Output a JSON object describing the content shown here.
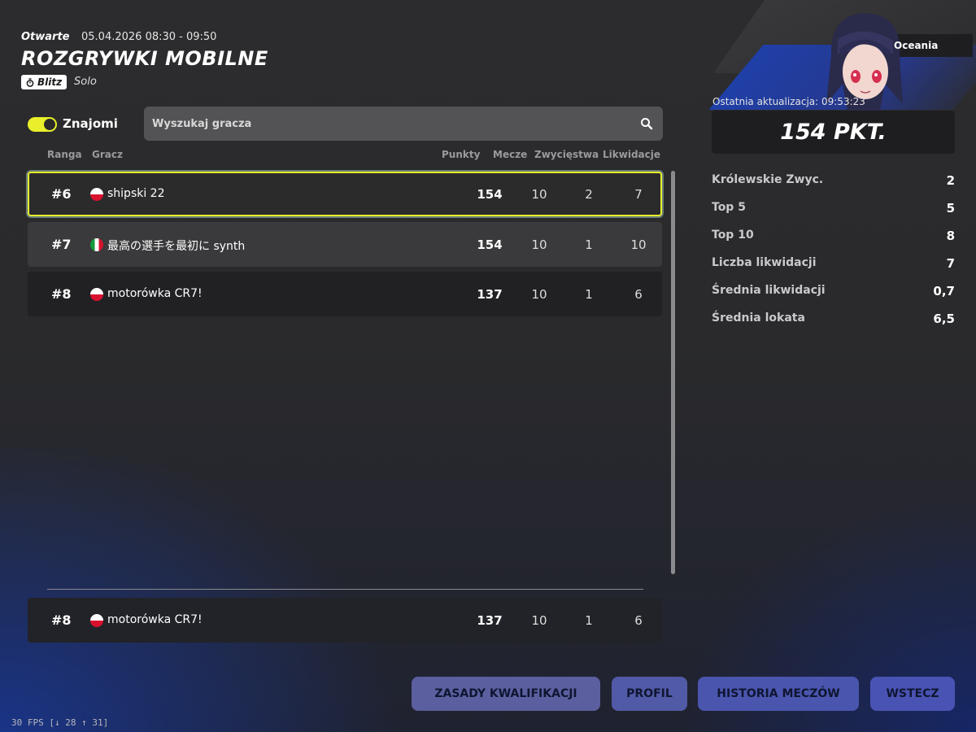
{
  "header": {
    "status": "Otwarte",
    "date_range": "05.04.2026 08:30 - 09:50",
    "title": "ROZGRYWKI MOBILNE",
    "mode_badge": "Blitz",
    "mode_type": "Solo"
  },
  "filters": {
    "friends_toggle_label": "Znajomi",
    "friends_toggle_on": true,
    "search_placeholder": "Wyszukaj gracza"
  },
  "columns": {
    "rank": "Ranga",
    "player": "Gracz",
    "points": "Punkty",
    "matches": "Mecze",
    "wins": "Zwycięstwa",
    "eliminations": "Likwidacje"
  },
  "leaderboard": [
    {
      "rank": "#6",
      "flag": "poland-flag-icon",
      "name": "shipski 22",
      "points": "154",
      "matches": "10",
      "wins": "2",
      "eliminations": "7",
      "selected": true
    },
    {
      "rank": "#7",
      "flag": "italy-flag-icon",
      "name": "最高の選手を最初に synth",
      "points": "154",
      "matches": "10",
      "wins": "1",
      "eliminations": "10"
    },
    {
      "rank": "#8",
      "flag": "poland-flag-icon",
      "name": "motorówka CR7!",
      "points": "137",
      "matches": "10",
      "wins": "1",
      "eliminations": "6"
    }
  ],
  "my_row": {
    "rank": "#8",
    "flag": "poland-flag-icon",
    "name": "motorówka CR7!",
    "points": "137",
    "matches": "10",
    "wins": "1",
    "eliminations": "6"
  },
  "profile": {
    "region": "Oceania",
    "last_update": "Ostatnia aktualizacja: 09:53:23",
    "score": "154 PKT.",
    "stats": [
      {
        "label": "Królewskie Zwyc.",
        "value": "2"
      },
      {
        "label": "Top 5",
        "value": "5"
      },
      {
        "label": "Top 10",
        "value": "8"
      },
      {
        "label": "Liczba likwidacji",
        "value": "7"
      },
      {
        "label": "Średnia likwidacji",
        "value": "0,7"
      },
      {
        "label": "Średnia lokata",
        "value": "6,5"
      }
    ]
  },
  "buttons": {
    "rules": "ZASADY KWALIFIKACJI",
    "profile": "PROFIL",
    "history": "HISTORIA MECZÓW",
    "back": "WSTECZ"
  },
  "fps": "30 FPS [↓ 28 ↑ 31]",
  "colors": {
    "accent_yellow": "#e8ee2a",
    "button_blue": "#4a55ae"
  }
}
